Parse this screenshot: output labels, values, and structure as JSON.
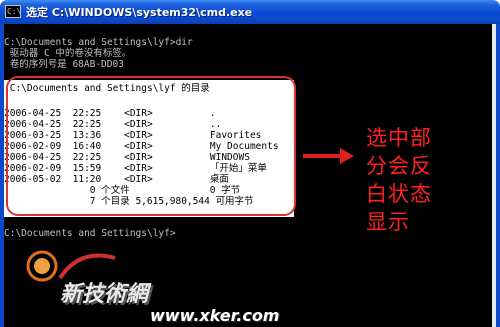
{
  "window": {
    "select_prefix": "选定",
    "title": "C:\\WINDOWS\\system32\\cmd.exe",
    "icon_glyph": "C:\\"
  },
  "console": {
    "before": [
      "C:\\Documents and Settings\\lyf>dir",
      " 驱动器 C 中的卷没有标签。",
      " 卷的序列号是 68AB-DD03"
    ],
    "selected": [
      " C:\\Documents and Settings\\lyf 的目录",
      "",
      "2006-04-25  22:25    <DIR>          .",
      "2006-04-25  22:25    <DIR>          ..",
      "2006-03-25  13:36    <DIR>          Favorites",
      "2006-02-09  16:40    <DIR>          My Documents",
      "2006-04-25  22:25    <DIR>          WINDOWS",
      "2006-02-09  15:59    <DIR>          「开始」菜单",
      "2006-05-02  11:20    <DIR>          桌面",
      "               0 个文件              0 字节",
      "               7 个目录 5,615,980,544 可用字节"
    ],
    "after": [
      "",
      "C:\\Documents and Settings\\lyf>"
    ]
  },
  "annotation": {
    "lines": [
      "选中部",
      "分会反",
      "白状态",
      "显示"
    ],
    "color": "#ff2020"
  },
  "watermark": {
    "brand": "新技術網",
    "url": "www.xker.com"
  }
}
